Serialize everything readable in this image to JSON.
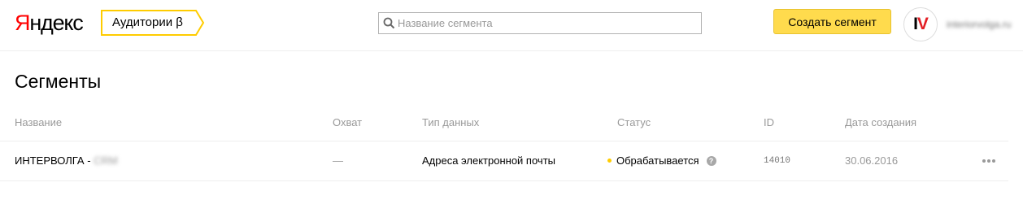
{
  "header": {
    "logo": {
      "first_letter": "Я",
      "rest": "ндекс"
    },
    "service_label": "Аудитории β",
    "search": {
      "placeholder": "Название сегмента",
      "value": ""
    },
    "create_button": "Создать сегмент",
    "avatar": {
      "letter_i": "I",
      "letter_v": "V"
    },
    "user_login": "interiorvolga.ru"
  },
  "main": {
    "title": "Сегменты",
    "columns": [
      "Название",
      "Охват",
      "Тип данных",
      "Статус",
      "ID",
      "Дата создания"
    ],
    "rows": [
      {
        "name_prefix": "ИНТЕРВОЛГА - ",
        "name_hidden": "CRM",
        "reach": "—",
        "data_type": "Адреса электронной почты",
        "status": "Обрабатывается",
        "status_help": "?",
        "id": "14010",
        "created": "30.06.2016"
      }
    ]
  },
  "colors": {
    "accent": "#ffdb4d",
    "status_processing": "#ffcc00",
    "brand_red": "#ff0000"
  },
  "icons": [
    "search-icon",
    "help-icon",
    "more-icon"
  ]
}
